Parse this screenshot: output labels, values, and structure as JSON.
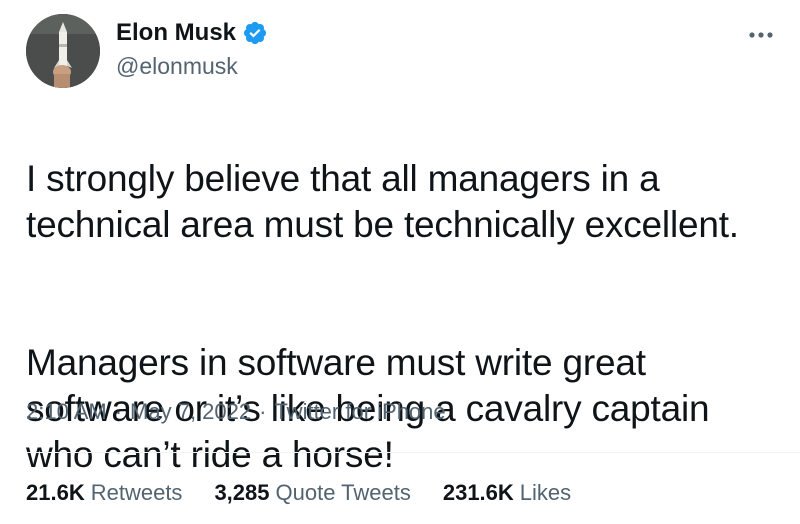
{
  "author": {
    "name": "Elon Musk",
    "handle": "@elonmusk",
    "verified": true
  },
  "tweet": {
    "paragraphs": [
      "I strongly believe that all managers in a\ntechnical area must be technically excellent.",
      "Managers in software must write great\nsoftware or it’s like being a cavalry captain\nwho can’t ride a horse!"
    ]
  },
  "meta": {
    "time": "2:10 AM",
    "separator": "·",
    "date": "May 7, 2022",
    "source": "Twitter for iPhone"
  },
  "stats": {
    "retweets_count": "21.6K",
    "retweets_label": "Retweets",
    "quotes_count": "3,285",
    "quotes_label": "Quote Tweets",
    "likes_count": "231.6K",
    "likes_label": "Likes"
  },
  "colors": {
    "text_primary": "#0f1419",
    "text_secondary": "#536471",
    "verified_blue": "#1d9bf0",
    "divider": "#eff3f4"
  },
  "icons": {
    "verified": "verified-badge-icon",
    "more": "more-horizontal-icon"
  }
}
